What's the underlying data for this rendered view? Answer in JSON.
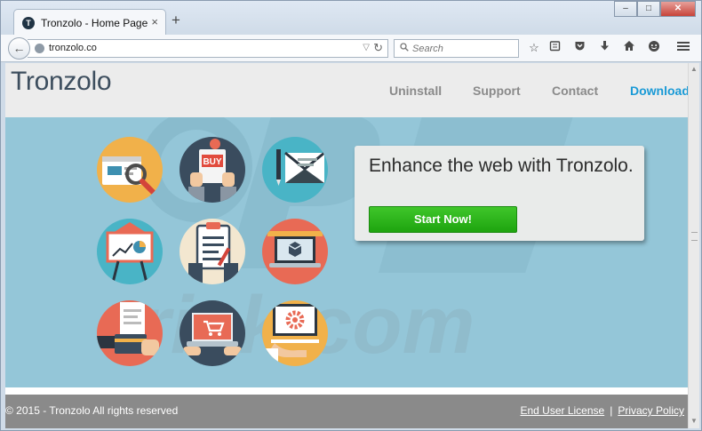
{
  "browser": {
    "tab_title": "Tronzolo - Home Page",
    "tab_favicon_letter": "T",
    "tab_close": "×",
    "new_tab": "+",
    "url": "tronzolo.co",
    "search_placeholder": "Search",
    "window_controls": {
      "minimize": "–",
      "maximize": "□",
      "close": "✕"
    }
  },
  "site": {
    "logo": "Tronzolo",
    "nav": {
      "uninstall": "Uninstall",
      "support": "Support",
      "contact": "Contact",
      "download": "Download"
    },
    "promo": {
      "headline": "Enhance the web with Tronzolo.",
      "button": "Start Now!"
    },
    "watermark": "risk.com",
    "footer": {
      "copyright": "© 2015 - Tronzolo All rights reserved",
      "end_user_license": "End User License",
      "separator": "|",
      "privacy_policy": "Privacy Policy"
    },
    "icon_grid": [
      "browser-magnifier-icon",
      "buy-tablet-icon",
      "pen-envelope-icon",
      "presentation-board-icon",
      "clipboard-icon",
      "laptop-box-icon",
      "receipt-card-icon",
      "laptop-cart-icon",
      "hand-gear-icon"
    ],
    "buy_label": "BUY"
  },
  "colors": {
    "accent": "#1a9ad6",
    "hero_bg": "#94c6d8",
    "button_green": "#2fb51d",
    "footer_bg": "#8a8a8a"
  }
}
